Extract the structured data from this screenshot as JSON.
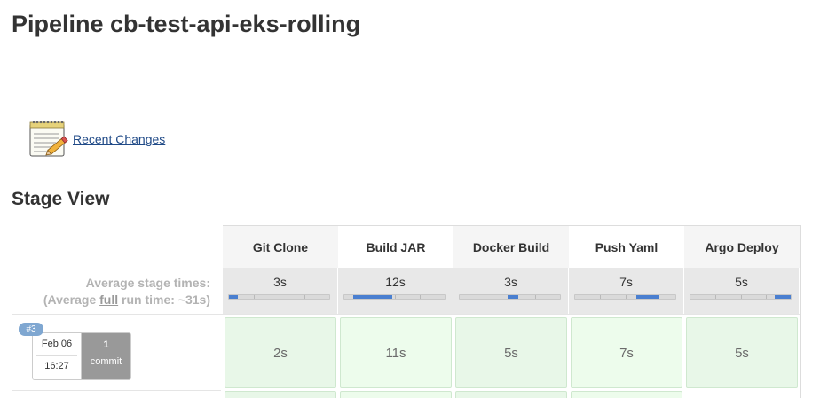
{
  "page": {
    "title": "Pipeline cb-test-api-eks-rolling"
  },
  "links": {
    "recent_changes": "Recent Changes"
  },
  "stage_view": {
    "title": "Stage View",
    "average_label": "Average stage times:",
    "average_full_prefix": "(Average ",
    "average_full_word": "full",
    "average_full_suffix": " run time: ~31s)",
    "stages": [
      {
        "name": "Git Clone",
        "avg_time": "3s",
        "bar_start": 0.0,
        "bar_end": 0.09
      },
      {
        "name": "Build JAR",
        "avg_time": "12s",
        "bar_start": 0.09,
        "bar_end": 0.48
      },
      {
        "name": "Docker Build",
        "avg_time": "3s",
        "bar_start": 0.48,
        "bar_end": 0.58
      },
      {
        "name": "Push Yaml",
        "avg_time": "7s",
        "bar_start": 0.61,
        "bar_end": 0.84
      },
      {
        "name": "Argo Deploy",
        "avg_time": "5s",
        "bar_start": 0.84,
        "bar_end": 1.0
      }
    ],
    "runs": [
      {
        "number": "#3",
        "date": "Feb 06",
        "time": "16:27",
        "commit_count": "1",
        "commit_label": "commit",
        "durations": [
          "2s",
          "11s",
          "5s",
          "7s",
          "5s"
        ]
      }
    ]
  },
  "colors": {
    "progress_fill": "#4a7fd0",
    "success_cell": "#e8f7e8",
    "badge": "#7fa7d1",
    "link": "#204a87"
  },
  "icons": {
    "recent_changes": "notepad-pencil-icon"
  }
}
